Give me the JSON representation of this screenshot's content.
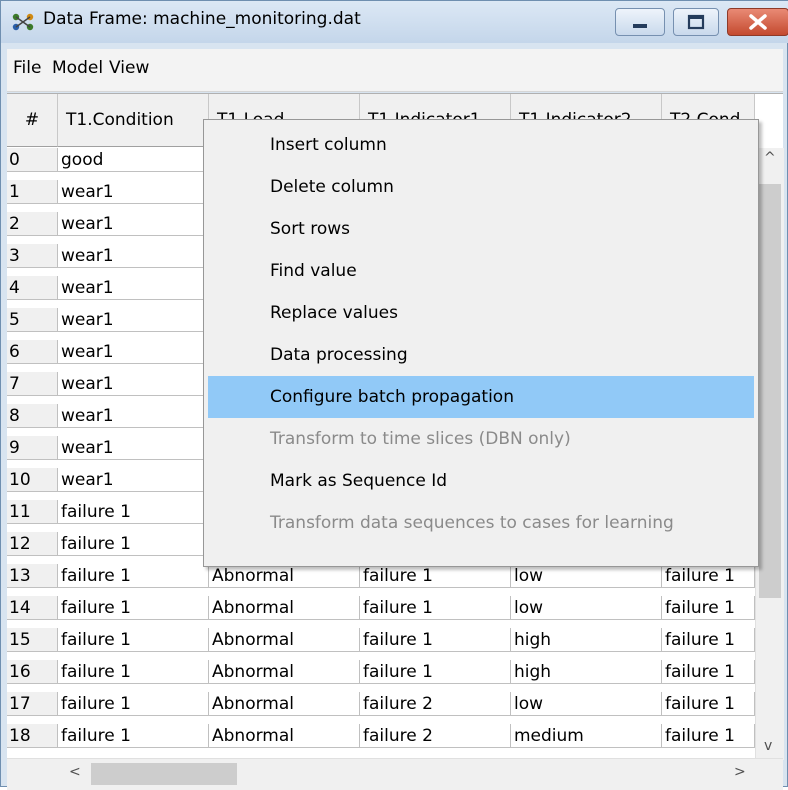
{
  "window": {
    "title": "Data Frame: machine_monitoring.dat",
    "icon": "network-graph-icon",
    "controls": [
      "minimize-icon",
      "maximize-icon",
      "close-icon"
    ]
  },
  "menubar": {
    "items": [
      "File",
      "Model",
      "View"
    ]
  },
  "table": {
    "columns": [
      "#",
      "T1.Condition",
      "T1.Load",
      "T1.Indicator1",
      "T1.Indicator2",
      "T2.Cond"
    ],
    "rows": [
      [
        "0",
        "good",
        "",
        "",
        "",
        ""
      ],
      [
        "1",
        "wear1",
        "",
        "",
        "",
        ""
      ],
      [
        "2",
        "wear1",
        "",
        "",
        "",
        ""
      ],
      [
        "3",
        "wear1",
        "",
        "",
        "",
        ""
      ],
      [
        "4",
        "wear1",
        "",
        "",
        "",
        ""
      ],
      [
        "5",
        "wear1",
        "",
        "",
        "",
        ""
      ],
      [
        "6",
        "wear1",
        "",
        "",
        "",
        ""
      ],
      [
        "7",
        "wear1",
        "",
        "",
        "",
        ""
      ],
      [
        "8",
        "wear1",
        "",
        "",
        "",
        ""
      ],
      [
        "9",
        "wear1",
        "",
        "",
        "",
        ""
      ],
      [
        "10",
        "wear1",
        "",
        "",
        "",
        ""
      ],
      [
        "11",
        "failure 1",
        "",
        "",
        "",
        ""
      ],
      [
        "12",
        "failure 1",
        "",
        "",
        "",
        ""
      ],
      [
        "13",
        "failure 1",
        "Abnormal",
        "failure 1",
        "low",
        "failure 1"
      ],
      [
        "14",
        "failure 1",
        "Abnormal",
        "failure 1",
        "low",
        "failure 1"
      ],
      [
        "15",
        "failure 1",
        "Abnormal",
        "failure 1",
        "high",
        "failure 1"
      ],
      [
        "16",
        "failure 1",
        "Abnormal",
        "failure 1",
        "high",
        "failure 1"
      ],
      [
        "17",
        "failure 1",
        "Abnormal",
        "failure 2",
        "low",
        "failure 1"
      ],
      [
        "18",
        "failure 1",
        "Abnormal",
        "failure 2",
        "medium",
        "failure 1"
      ]
    ]
  },
  "context_menu": {
    "items": [
      {
        "label": "Insert column",
        "state": "normal"
      },
      {
        "label": "Delete column",
        "state": "normal"
      },
      {
        "label": "Sort rows",
        "state": "normal"
      },
      {
        "label": "Find value",
        "state": "normal"
      },
      {
        "label": "Replace values",
        "state": "normal"
      },
      {
        "label": "Data processing",
        "state": "normal"
      },
      {
        "label": "Configure batch propagation",
        "state": "highlighted"
      },
      {
        "label": "Transform to time slices (DBN only)",
        "state": "disabled"
      },
      {
        "label": "Mark as Sequence Id",
        "state": "normal"
      },
      {
        "label": "Transform data sequences to cases for learning",
        "state": "disabled"
      }
    ]
  },
  "scrollbars": {
    "vertical": {
      "up": "^",
      "down": "v"
    },
    "horizontal": {
      "left": "<",
      "right": ">"
    }
  },
  "colors": {
    "highlight": "#91c9f7",
    "disabled_text": "#8a8a8a",
    "close_button": "#c44a2f"
  }
}
